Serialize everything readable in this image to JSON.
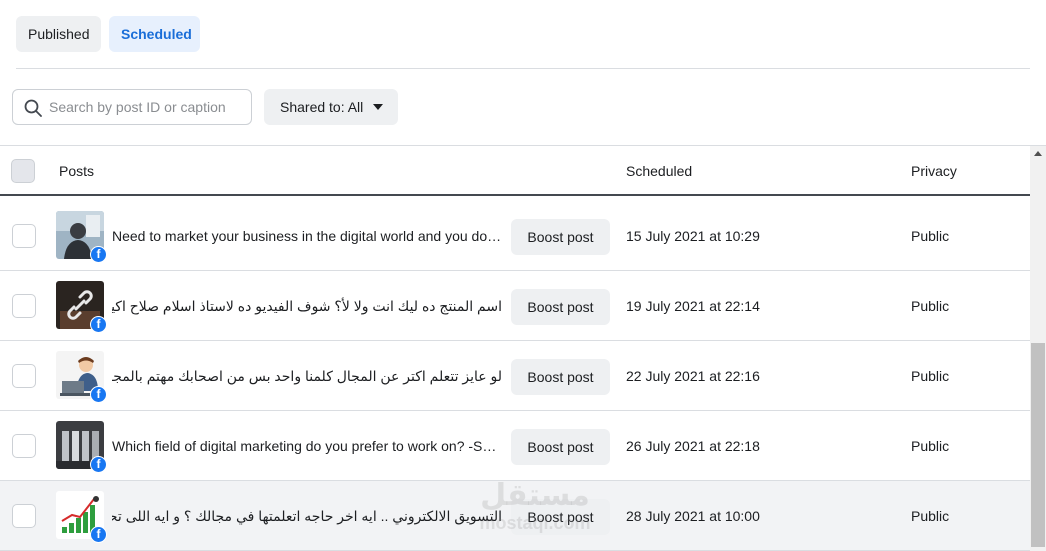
{
  "tabs": [
    {
      "label": "Published",
      "active": false
    },
    {
      "label": "Scheduled",
      "active": true
    }
  ],
  "search": {
    "placeholder": "Search by post ID or caption",
    "value": "",
    "icon": "search-icon"
  },
  "shared_filter": {
    "label": "Shared to: All",
    "icon": "caret-down-icon"
  },
  "table": {
    "headers": {
      "posts": "Posts",
      "scheduled": "Scheduled",
      "privacy": "Privacy"
    },
    "rows": [
      {
        "caption": "Need to market your business in the digital world and you don't know how?",
        "boost_label": "Boost post",
        "scheduled": "15 July 2021 at 10:29",
        "privacy": "Public",
        "thumb": "person-back-photo"
      },
      {
        "caption": "اسم المنتج ده ليك انت ولا لأ؟ شوف الفيديو ده لاستاذ اسلام صلاح اكيد هيفيدك شير مع اصحابك المهتمين بالمجال",
        "boost_label": "Boost post",
        "scheduled": "19 July 2021 at 22:14",
        "privacy": "Public",
        "thumb": "link-photo"
      },
      {
        "caption": "لو عايز تتعلم اكتر عن المجال كلمنا واحد بس من اصحابك مهتم بالمجال و ابعت مسج و هبعتلك لينك التقديم والتفاصيل كاملة",
        "boost_label": "Boost post",
        "scheduled": "22 July 2021 at 22:16",
        "privacy": "Public",
        "thumb": "man-laptop-illustration"
      },
      {
        "caption": "Which field of digital marketing do you prefer to work on? -Social media marketing",
        "boost_label": "Boost post",
        "scheduled": "26 July 2021 at 22:18",
        "privacy": "Public",
        "thumb": "columns-photo"
      },
      {
        "caption": "التسويق الالكتروني .. ايه اخر حاجه اتعلمتها في مجالك ؟ و ايه اللى تحب نساعدك تتعلمه؟؟؟",
        "boost_label": "Boost post",
        "scheduled": "28 July 2021 at 10:00",
        "privacy": "Public",
        "thumb": "growth-chart-illustration",
        "hovered": true
      }
    ]
  },
  "watermark": {
    "line1": "مستقل",
    "line2": "mostaql.com"
  },
  "colors": {
    "accent": "#1a6ed8",
    "facebook": "#1877f2",
    "tab_active_bg": "#e7f0fd"
  }
}
